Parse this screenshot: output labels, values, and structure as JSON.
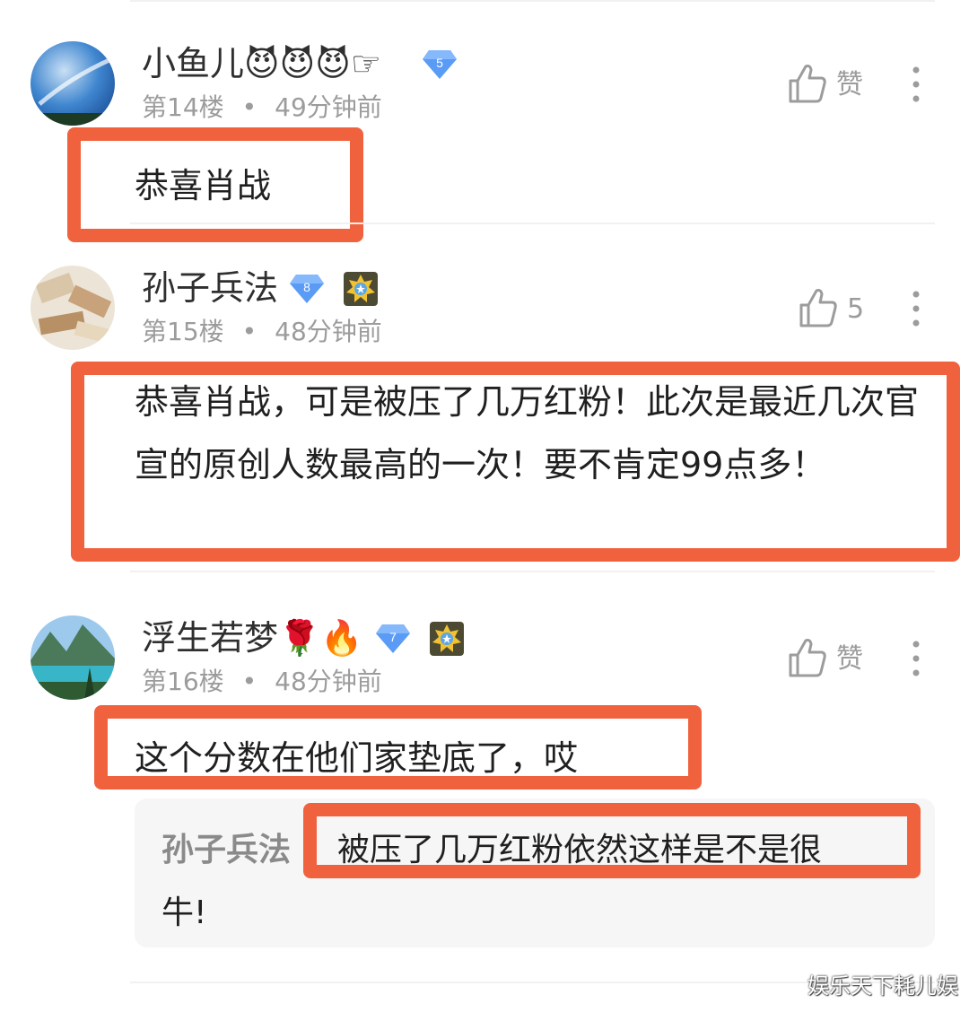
{
  "comments": [
    {
      "username": "小鱼儿😈😈😈☞",
      "level_badge": "5",
      "floor": "第14楼",
      "time": "49分钟前",
      "like_label": "赞",
      "text": "恭喜肖战"
    },
    {
      "username": "孙子兵法",
      "level_badge": "8",
      "floor": "第15楼",
      "time": "48分钟前",
      "like_label": "5",
      "text": "恭喜肖战，可是被压了几万红粉！此次是最近几次官宣的原创人数最高的一次！要不肯定99点多！"
    },
    {
      "username": "浮生若梦🌹🔥",
      "level_badge": "7",
      "floor": "第16楼",
      "time": "48分钟前",
      "like_label": "赞",
      "text": "这个分数在他们家垫底了，哎",
      "reply": {
        "author": "孙子兵法",
        "text_line1": "被压了几万红粉依然这样是不是很",
        "text_line2": "牛!"
      }
    }
  ],
  "separator": "•",
  "watermark": "娱乐天下耗儿娱",
  "colors": {
    "highlight_border": "#f0623e",
    "meta_text": "#9c9c9c",
    "badge_blue": "#5a9bf5",
    "quote_bg": "#f6f6f6"
  },
  "icons": {
    "like": "thumbs-up-icon",
    "more": "more-vertical-icon",
    "level": "diamond-level-icon",
    "medal": "gold-medal-icon"
  }
}
